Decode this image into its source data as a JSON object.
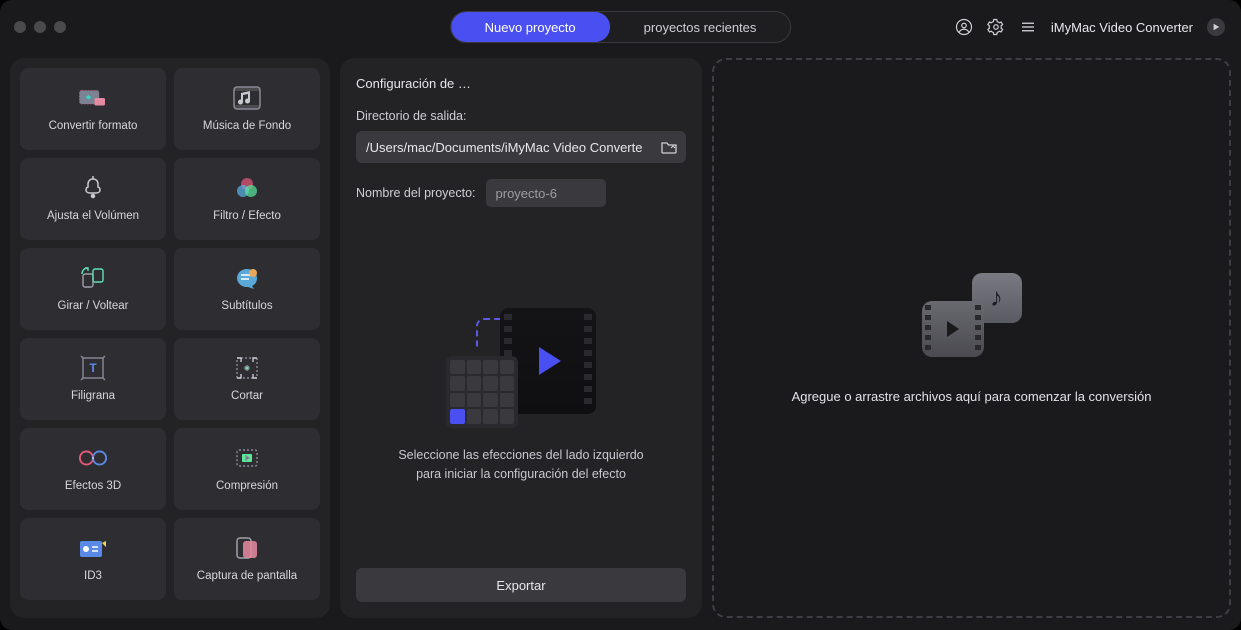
{
  "header": {
    "tabs": {
      "new_project": "Nuevo proyecto",
      "recent_projects": "proyectos recientes"
    },
    "app_name": "iMyMac Video Converter"
  },
  "sidebar": {
    "tools": [
      {
        "key": "convert-format",
        "label": "Convertir formato"
      },
      {
        "key": "background-music",
        "label": "Música de Fondo"
      },
      {
        "key": "adjust-volume",
        "label": "Ajusta el Volúmen"
      },
      {
        "key": "filter-effect",
        "label": "Filtro / Efecto"
      },
      {
        "key": "rotate-flip",
        "label": "Girar / Voltear"
      },
      {
        "key": "subtitles",
        "label": "Subtítulos"
      },
      {
        "key": "watermark",
        "label": "Filigrana"
      },
      {
        "key": "trim",
        "label": "Cortar"
      },
      {
        "key": "effects-3d",
        "label": "Efectos 3D"
      },
      {
        "key": "compression",
        "label": "Compresión"
      },
      {
        "key": "id3",
        "label": "ID3"
      },
      {
        "key": "screenshot",
        "label": "Captura de pantalla"
      }
    ]
  },
  "config": {
    "title": "Configuración de …",
    "outdir_label": "Directorio de salida:",
    "outdir_value": "/Users/mac/Documents/iMyMac Video Converte",
    "project_name_label": "Nombre del proyecto:",
    "project_name_value": "proyecto-6",
    "hint_line1": "Seleccione las efecciones del lado izquierdo",
    "hint_line2": "para iniciar la configuración del efecto",
    "export_label": "Exportar"
  },
  "dropzone": {
    "text": "Agregue o arrastre archivos aquí para comenzar la conversión"
  }
}
